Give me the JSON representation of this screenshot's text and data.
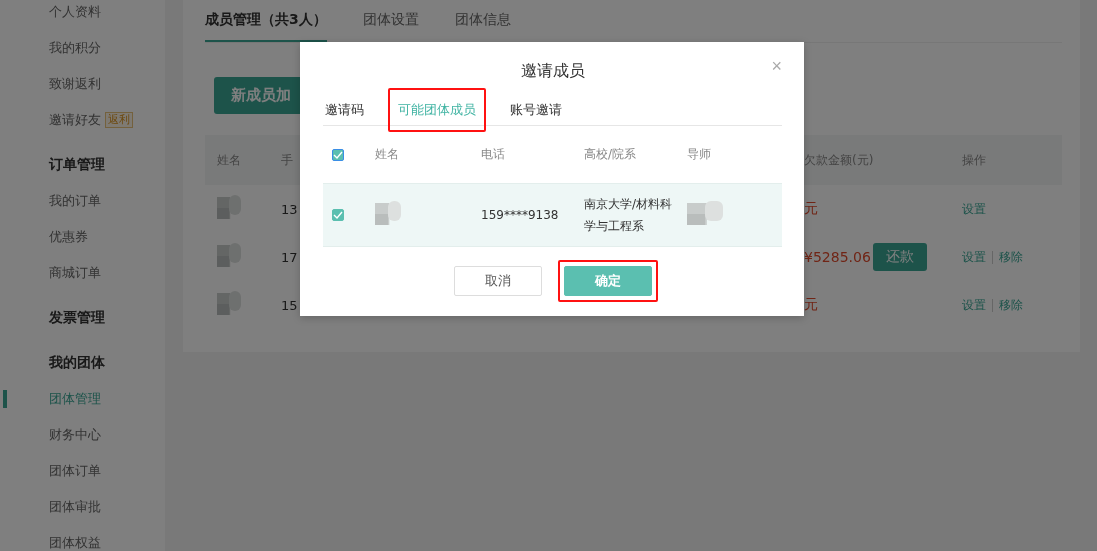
{
  "sidebar": {
    "items": [
      {
        "kind": "item",
        "label": "个人资料",
        "selected": false
      },
      {
        "kind": "item",
        "label": "我的积分",
        "selected": false
      },
      {
        "kind": "item",
        "label": "致谢返利",
        "selected": false
      },
      {
        "kind": "item",
        "label": "邀请好友",
        "badge": "返利",
        "selected": false
      },
      {
        "kind": "heading",
        "label": "订单管理"
      },
      {
        "kind": "item",
        "label": "我的订单",
        "selected": false
      },
      {
        "kind": "item",
        "label": "优惠券",
        "selected": false
      },
      {
        "kind": "item",
        "label": "商城订单",
        "selected": false
      },
      {
        "kind": "heading",
        "label": "发票管理"
      },
      {
        "kind": "heading",
        "label": "我的团体"
      },
      {
        "kind": "item",
        "label": "团体管理",
        "selected": true
      },
      {
        "kind": "item",
        "label": "财务中心",
        "selected": false
      },
      {
        "kind": "item",
        "label": "团体订单",
        "selected": false
      },
      {
        "kind": "item",
        "label": "团体审批",
        "selected": false
      },
      {
        "kind": "item",
        "label": "团体权益",
        "selected": false
      }
    ]
  },
  "main": {
    "tabs": [
      {
        "label": "成员管理（共3人）",
        "selected": true
      },
      {
        "label": "团体设置",
        "selected": false
      },
      {
        "label": "团体信息",
        "selected": false
      }
    ],
    "add_button": "新成员加",
    "table": {
      "columns": [
        "姓名",
        "手",
        "欠款金额(元)",
        "操作"
      ],
      "rows": [
        {
          "column_2": "13",
          "amount": "元",
          "actions": [
            "设置"
          ]
        },
        {
          "column_2": "17",
          "amount": "¥5285.06",
          "repay_button": "还款",
          "actions": [
            "设置",
            "移除"
          ]
        },
        {
          "column_2": "15",
          "amount": "元",
          "actions": [
            "设置",
            "移除"
          ]
        }
      ]
    }
  },
  "dialog": {
    "title": "邀请成员",
    "close": "×",
    "tabs": [
      {
        "label": "邀请码",
        "selected": false,
        "highlighted": false
      },
      {
        "label": "可能团体成员",
        "selected": true,
        "highlighted": true
      },
      {
        "label": "账号邀请",
        "selected": false,
        "highlighted": false
      }
    ],
    "table": {
      "all_checked": true,
      "columns": [
        "姓名",
        "电话",
        "高校/院系",
        "导师"
      ],
      "rows": [
        {
          "checked": true,
          "phone": "159****9138",
          "school": "南京大学/材料科学与工程系"
        }
      ]
    },
    "buttons": [
      {
        "label": "取消",
        "kind": "secondary",
        "highlighted": false
      },
      {
        "label": "确定",
        "kind": "primary",
        "highlighted": true
      }
    ]
  }
}
